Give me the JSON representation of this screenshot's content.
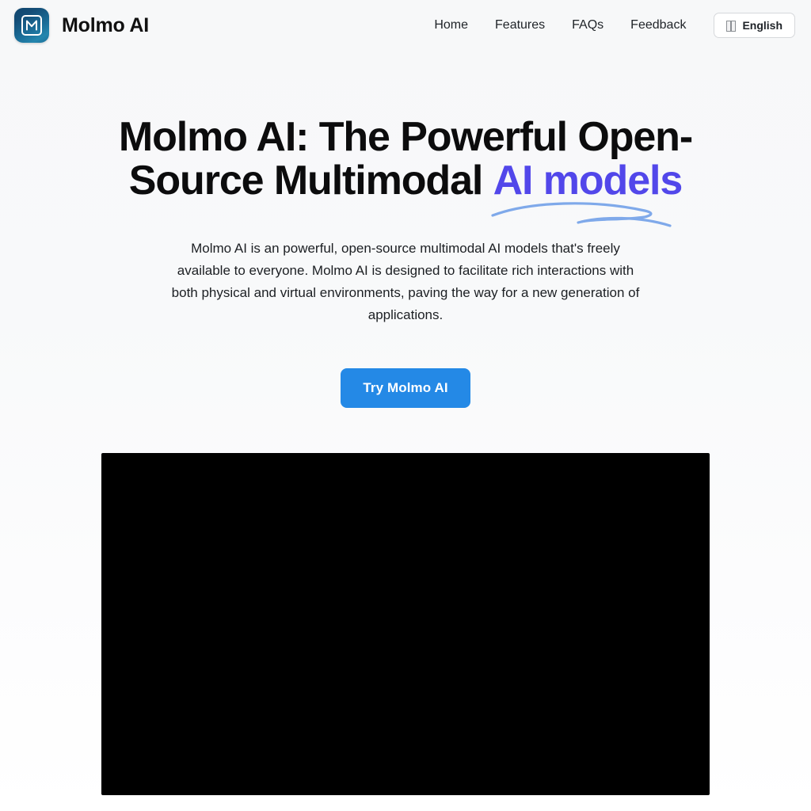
{
  "header": {
    "brand": {
      "logo_letter": "M",
      "logo_icon": "molmo-logo-icon",
      "name": "Molmo AI"
    },
    "nav": [
      {
        "label": "Home"
      },
      {
        "label": "Features"
      },
      {
        "label": "FAQs"
      },
      {
        "label": "Feedback"
      }
    ],
    "language": {
      "label": "English",
      "icon": "language-globe-icon"
    }
  },
  "hero": {
    "title_lead": "Molmo AI: The Powerful Open-Source Multimodal ",
    "title_accent": "AI models",
    "accent_color": "#5247ea",
    "subtitle": "Molmo AI is an powerful, open-source multimodal AI models that's freely available to everyone. Molmo AI is designed to facilitate rich interactions with both physical and virtual environments, paving the way for a new generation of applications.",
    "cta_label": "Try Molmo AI",
    "cta_color": "#2489e6"
  },
  "video": {
    "label": "embedded-video-player",
    "background_color": "#000000"
  },
  "theme": {
    "page_background_top": "#f7f8f9",
    "page_background_bottom": "#ffffff",
    "text_color": "#111111",
    "underline_color": "#7fa9ea"
  }
}
